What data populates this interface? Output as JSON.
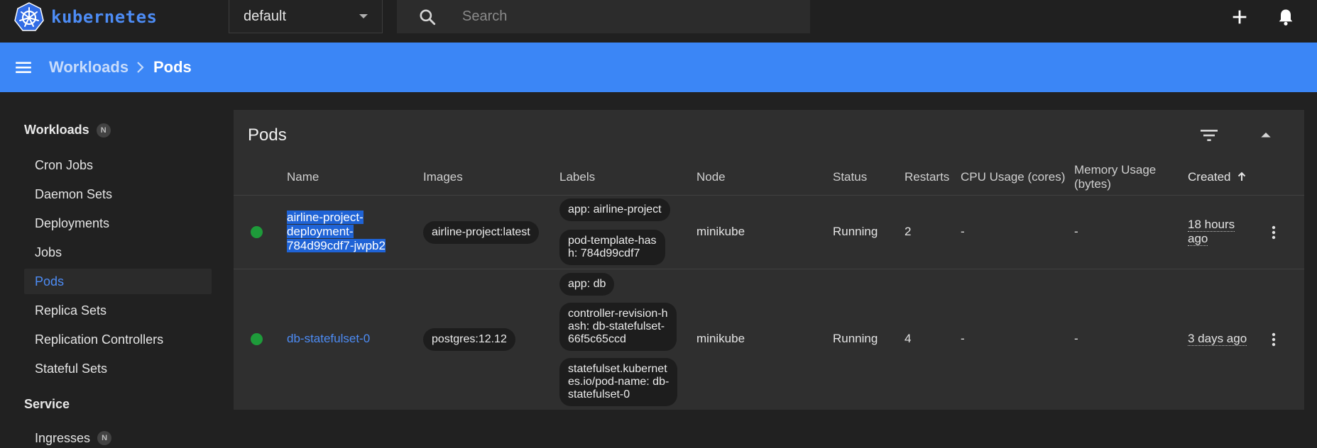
{
  "app": {
    "title": "kubernetes",
    "colors": {
      "accent": "#3b86f6",
      "link": "#4d8cf5",
      "running": "#1e9b3a"
    }
  },
  "namespace": {
    "selected": "default"
  },
  "search": {
    "placeholder": "Search"
  },
  "topbar_icons": [
    "search-icon",
    "add-icon",
    "notifications-icon"
  ],
  "breadcrumb": {
    "parent": "Workloads",
    "current": "Pods"
  },
  "sidebar": {
    "groups": [
      {
        "label": "Workloads",
        "badge": "N"
      },
      {
        "label": "Service"
      }
    ],
    "workload_items": [
      {
        "label": "Cron Jobs"
      },
      {
        "label": "Daemon Sets"
      },
      {
        "label": "Deployments"
      },
      {
        "label": "Jobs"
      },
      {
        "label": "Pods",
        "active": true
      },
      {
        "label": "Replica Sets"
      },
      {
        "label": "Replication Controllers"
      },
      {
        "label": "Stateful Sets"
      }
    ],
    "service_items": [
      {
        "label": "Ingresses",
        "badge": "N"
      }
    ]
  },
  "pods": {
    "title": "Pods",
    "columns": {
      "name": "Name",
      "images": "Images",
      "labels": "Labels",
      "node": "Node",
      "status": "Status",
      "restarts": "Restarts",
      "cpu": "CPU Usage (cores)",
      "memory_line1": "Memory Usage",
      "memory_line2": "(bytes)",
      "created": "Created"
    },
    "rows": [
      {
        "name_lines": [
          "airline-project-",
          "deployment-",
          "784d99cdf7-jwpb2"
        ],
        "image": "airline-project:latest",
        "labels": [
          [
            "app: airline-project"
          ],
          [
            "pod-template-has",
            "h: 784d99cdf7"
          ]
        ],
        "node": "minikube",
        "status": "Running",
        "restarts": "2",
        "cpu": "-",
        "memory": "-",
        "created_lines": [
          "18 hours",
          "ago"
        ]
      },
      {
        "name_lines": [
          "db-statefulset-0"
        ],
        "image": "postgres:12.12",
        "labels": [
          [
            "app: db"
          ],
          [
            "controller-revision-h",
            "ash: db-statefulset-",
            "66f5c65ccd"
          ],
          [
            "statefulset.kubernet",
            "es.io/pod-name: db-",
            "statefulset-0"
          ]
        ],
        "node": "minikube",
        "status": "Running",
        "restarts": "4",
        "cpu": "-",
        "memory": "-",
        "created_lines": [
          "3 days ago"
        ]
      }
    ]
  }
}
